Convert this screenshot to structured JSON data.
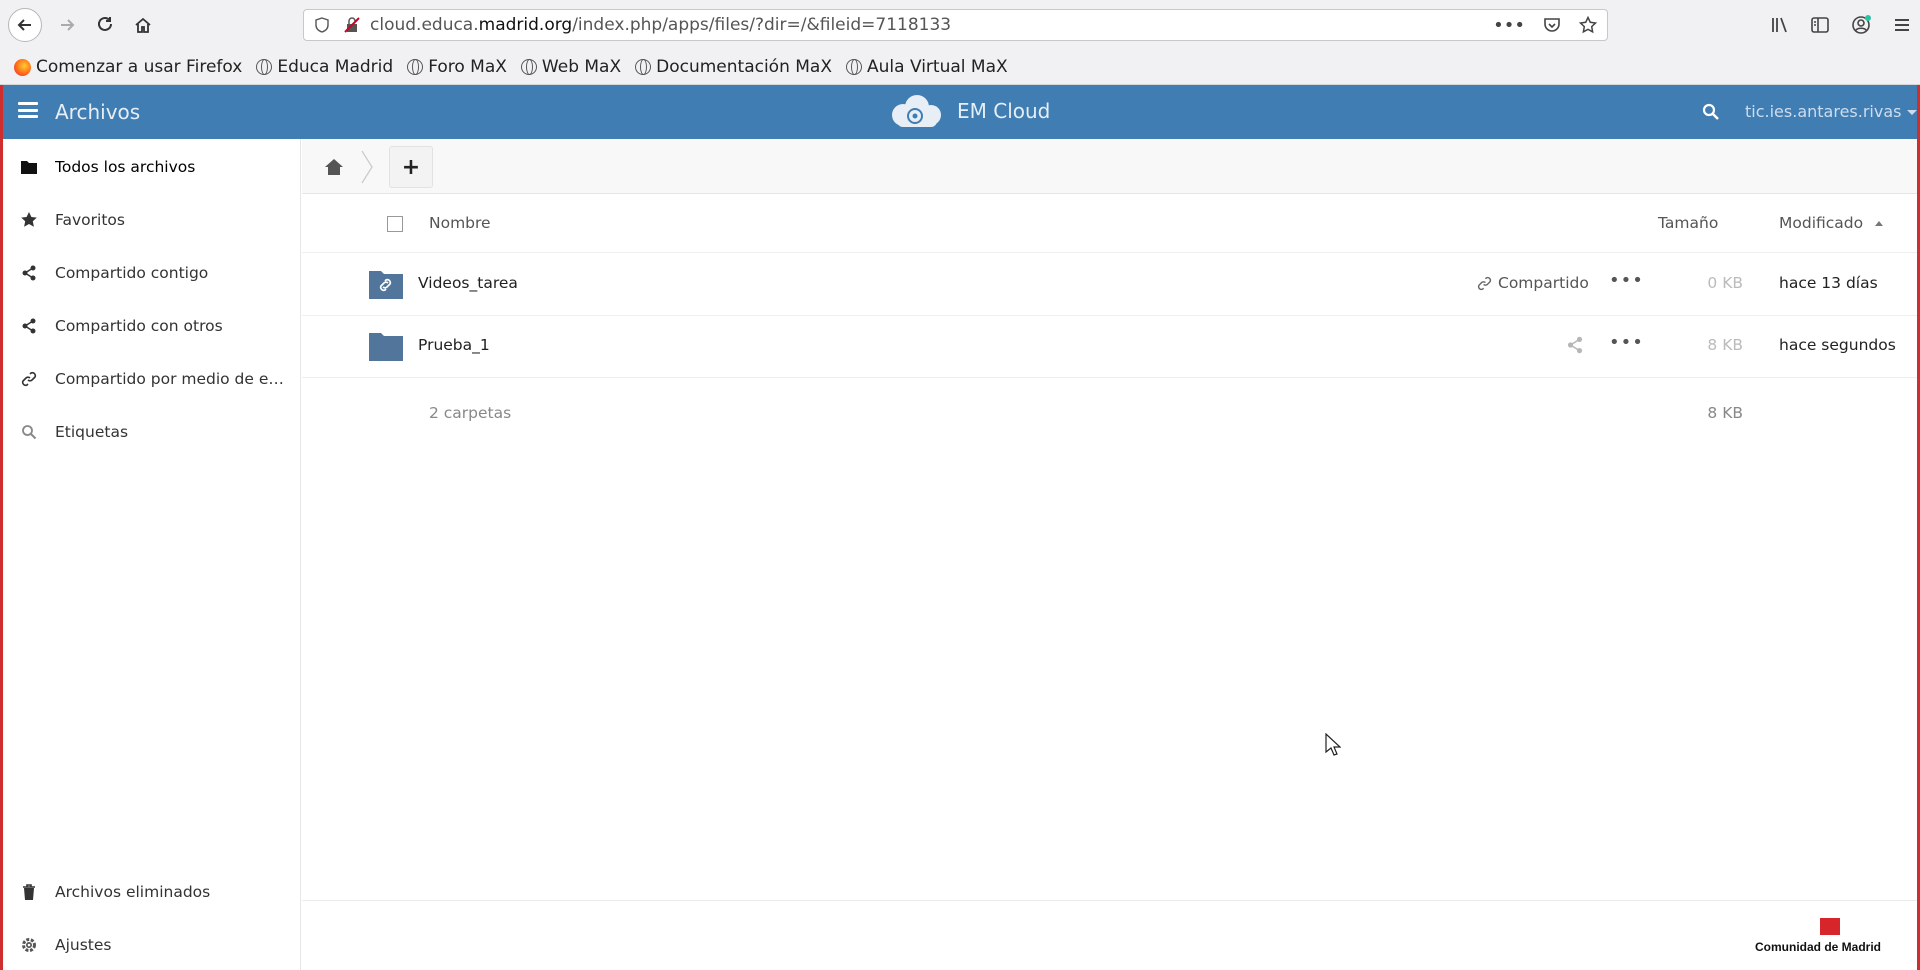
{
  "browser": {
    "url_prefix": "cloud.educa.",
    "url_domain": "madrid.org",
    "url_path": "/index.php/apps/files/?dir=/&fileid=7118133",
    "bookmarks": [
      "Comenzar a usar Firefox",
      "Educa Madrid",
      "Foro MaX",
      "Web MaX",
      "Documentación MaX",
      "Aula Virtual MaX"
    ]
  },
  "header": {
    "app_title": "Archivos",
    "brand": "EM Cloud",
    "user": "tic.ies.antares.rivas",
    "color": "#3f7db3"
  },
  "sidebar": {
    "items": [
      {
        "label": "Todos los archivos",
        "icon": "folder-icon"
      },
      {
        "label": "Favoritos",
        "icon": "star-icon"
      },
      {
        "label": "Compartido contigo",
        "icon": "share-icon"
      },
      {
        "label": "Compartido con otros",
        "icon": "share-icon"
      },
      {
        "label": "Compartido por medio de enla...",
        "icon": "link-icon"
      },
      {
        "label": "Etiquetas",
        "icon": "search-icon"
      }
    ],
    "bottom": [
      {
        "label": "Archivos eliminados",
        "icon": "trash-icon"
      },
      {
        "label": "Ajustes",
        "icon": "gear-icon"
      }
    ]
  },
  "controls": {
    "add_label": "+"
  },
  "table": {
    "col_name": "Nombre",
    "col_size": "Tamaño",
    "col_modified": "Modificado",
    "rows": [
      {
        "name": "Videos_tarea",
        "shared": "Compartido",
        "size": "0 KB",
        "modified": "hace 13 días"
      },
      {
        "name": "Prueba_1",
        "shared": "",
        "size": "8 KB",
        "modified": "hace segundos"
      }
    ],
    "summary_count": "2 carpetas",
    "summary_size": "8 KB"
  },
  "footer": {
    "logo_text": "Comunidad de Madrid"
  }
}
